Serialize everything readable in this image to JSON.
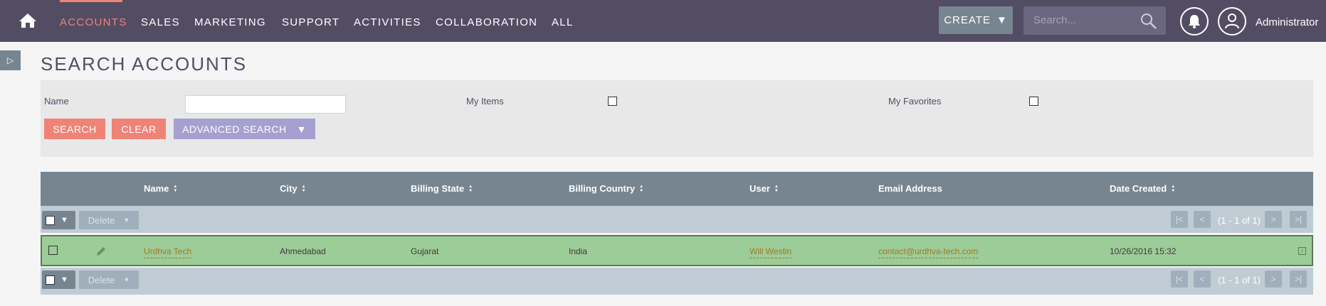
{
  "nav": {
    "items": [
      "ACCOUNTS",
      "SALES",
      "MARKETING",
      "SUPPORT",
      "ACTIVITIES",
      "COLLABORATION",
      "ALL"
    ],
    "create_label": "CREATE",
    "search_placeholder": "Search...",
    "user_name": "Administrator"
  },
  "page": {
    "title": "SEARCH ACCOUNTS"
  },
  "search_form": {
    "name_label": "Name",
    "name_value": "",
    "my_items_label": "My Items",
    "my_favorites_label": "My Favorites",
    "search_button": "SEARCH",
    "clear_button": "CLEAR",
    "advanced_button": "ADVANCED SEARCH"
  },
  "table": {
    "columns": [
      "Name",
      "City",
      "Billing State",
      "Billing Country",
      "User",
      "Email Address",
      "Date Created"
    ],
    "delete_label": "Delete",
    "pagination": "(1 - 1 of 1)",
    "rows": [
      {
        "name": "Urdhva Tech",
        "city": "Ahmedabad",
        "billing_state": "Gujarat",
        "billing_country": "India",
        "user": "Will Westin",
        "email": "contact@urdhva-tech.com",
        "date_created": "10/26/2016 15:32"
      }
    ]
  },
  "colors": {
    "nav_bg": "#534d64",
    "accent": "#f08377",
    "header_bg": "#778591",
    "row_highlight": "#9ccc97"
  }
}
